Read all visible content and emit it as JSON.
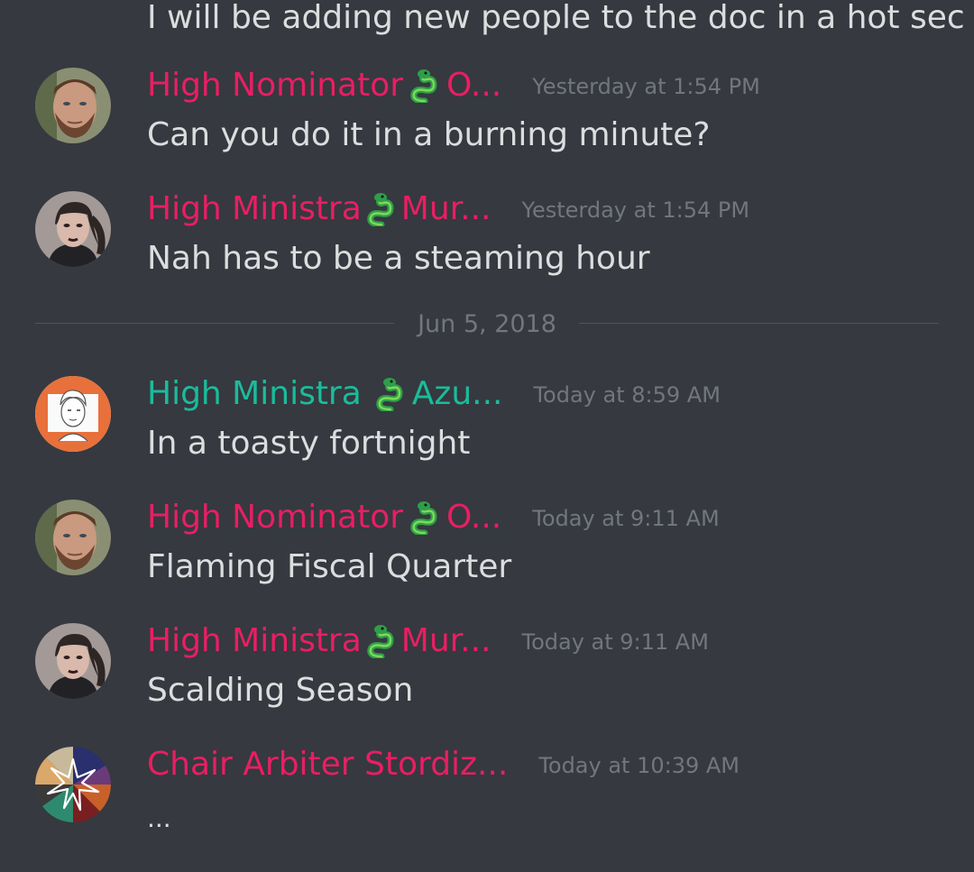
{
  "colors": {
    "background": "#36393f",
    "text": "#dcddde",
    "muted": "#72767d",
    "pink_role": "#e91e63",
    "teal_role": "#1abc9c"
  },
  "top_message": {
    "text": "I will be adding new people to the doc in a hot sec"
  },
  "date_divider": {
    "label": "Jun 5, 2018"
  },
  "messages": [
    {
      "author_prefix": "High Nominator",
      "author_suffix": "O...",
      "role_color": "#e91e63",
      "avatar": "bearded-man-avatar",
      "emoji": "snake-emoji",
      "timestamp": "Yesterday at 1:54 PM",
      "text": "Can you do it in a burning minute?"
    },
    {
      "author_prefix": "High Ministra",
      "author_suffix": "Mur...",
      "role_color": "#e91e63",
      "avatar": "dark-haired-woman-avatar",
      "emoji": "snake-emoji",
      "timestamp": "Yesterday at 1:54 PM",
      "text": "Nah has to be a steaming hour"
    },
    {
      "author_prefix": "High Ministra",
      "author_suffix": "Azu...",
      "role_color": "#1abc9c",
      "avatar": "sketch-portrait-avatar",
      "emoji": "snake-emoji",
      "timestamp": "Today at 8:59 AM",
      "text": "In a toasty fortnight"
    },
    {
      "author_prefix": "High Nominator",
      "author_suffix": "O...",
      "role_color": "#e91e63",
      "avatar": "bearded-man-avatar",
      "emoji": "snake-emoji",
      "timestamp": "Today at 9:11 AM",
      "text": "Flaming Fiscal Quarter"
    },
    {
      "author_prefix": "High Ministra",
      "author_suffix": "Mur...",
      "role_color": "#e91e63",
      "avatar": "dark-haired-woman-avatar",
      "emoji": "snake-emoji",
      "timestamp": "Today at 9:11 AM",
      "text": "Scalding Season"
    },
    {
      "author_prefix": "Chair Arbiter Stordiz...",
      "author_suffix": "",
      "role_color": "#e91e63",
      "avatar": "star-wheel-avatar",
      "emoji": "",
      "timestamp": "Today at 10:39 AM",
      "text": "..."
    }
  ]
}
